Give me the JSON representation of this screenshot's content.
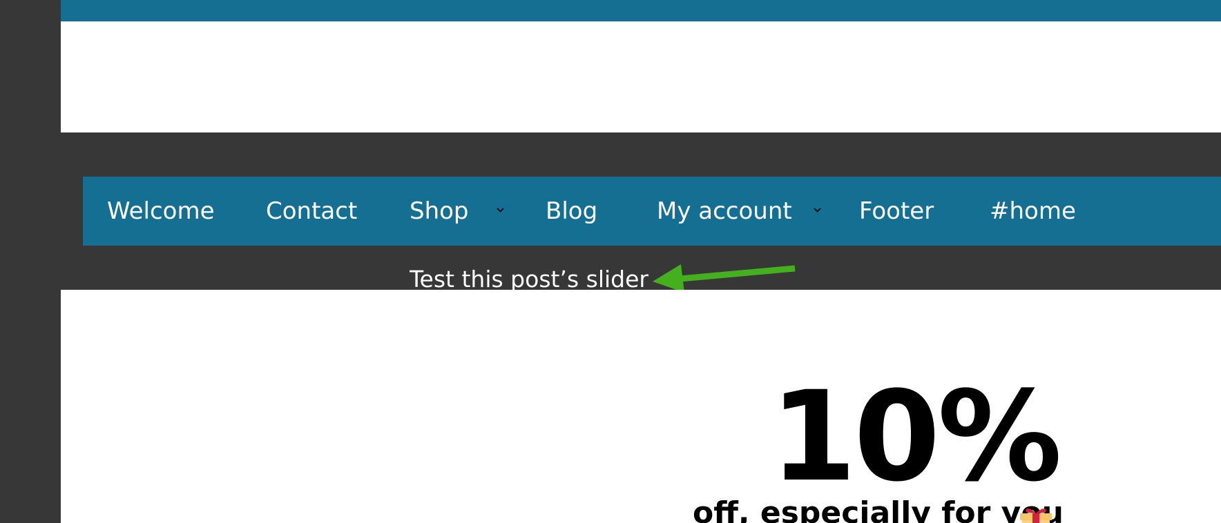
{
  "nav": {
    "items": [
      {
        "label": "Welcome",
        "has_dropdown": false
      },
      {
        "label": "Contact",
        "has_dropdown": false
      },
      {
        "label": "Shop",
        "has_dropdown": true
      },
      {
        "label": "Blog",
        "has_dropdown": false
      },
      {
        "label": "My account",
        "has_dropdown": true
      },
      {
        "label": "Footer",
        "has_dropdown": false
      },
      {
        "label": "#home",
        "has_dropdown": false
      }
    ],
    "submenu": {
      "item_label": "Test this post’s slider"
    }
  },
  "promo": {
    "percent": "10%",
    "line": "off, especially for you",
    "icon": "gift-icon"
  },
  "colors": {
    "nav_blue": "#156f92",
    "dark_bg": "#373737",
    "arrow_green": "#44b01e"
  }
}
